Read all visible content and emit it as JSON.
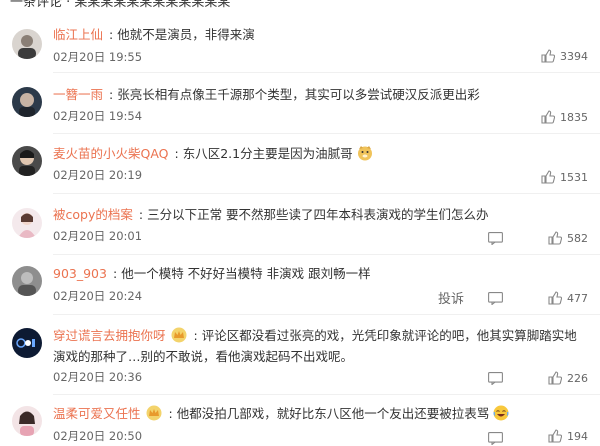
{
  "top_cut_text": "一条评论 · 某某某某某某某某某某某某",
  "icons": {
    "reply": "reply-icon",
    "like": "thumbs-up-icon"
  },
  "colors": {
    "username": "#eb7350",
    "text": "#333333",
    "meta": "#666666"
  },
  "comments": [
    {
      "user": "临江上仙",
      "text": "他就不是演员，非得来演",
      "time": "02月20日 19:55",
      "likes": "3394"
    },
    {
      "user": "一簪一雨",
      "text": "张亮长相有点像王千源那个类型，其实可以多尝试硬汉反派更出彩",
      "time": "02月20日 19:54",
      "likes": "1835"
    },
    {
      "user": "麦火苗的小火柴QAQ",
      "text": "东八区2.1分主要是因为油腻哥",
      "time": "02月20日 20:19",
      "likes": "1531"
    },
    {
      "user": "被copy的档案",
      "text": "三分以下正常 要不然那些读了四年本科表演戏的学生们怎么办",
      "time": "02月20日 20:01",
      "likes": "582"
    },
    {
      "user": "903_903",
      "text": "他一个模特 不好好当模特 非演戏 跟刘畅一样",
      "time": "02月20日 20:24",
      "likes": "477",
      "report": "投诉"
    },
    {
      "user": "穿过谎言去拥抱你呀",
      "text": "评论区都没看过张亮的戏，光凭印象就评论的吧，他其实算脚踏实地演戏的那种了…别的不敢说，看他演戏起码不出戏呢。",
      "time": "02月20日 20:36",
      "likes": "226"
    },
    {
      "user": "温柔可爱又任性",
      "text": "他都没拍几部戏，就好比东八区他一个友出还要被拉表骂",
      "time": "02月20日 20:50",
      "likes": "194"
    }
  ]
}
